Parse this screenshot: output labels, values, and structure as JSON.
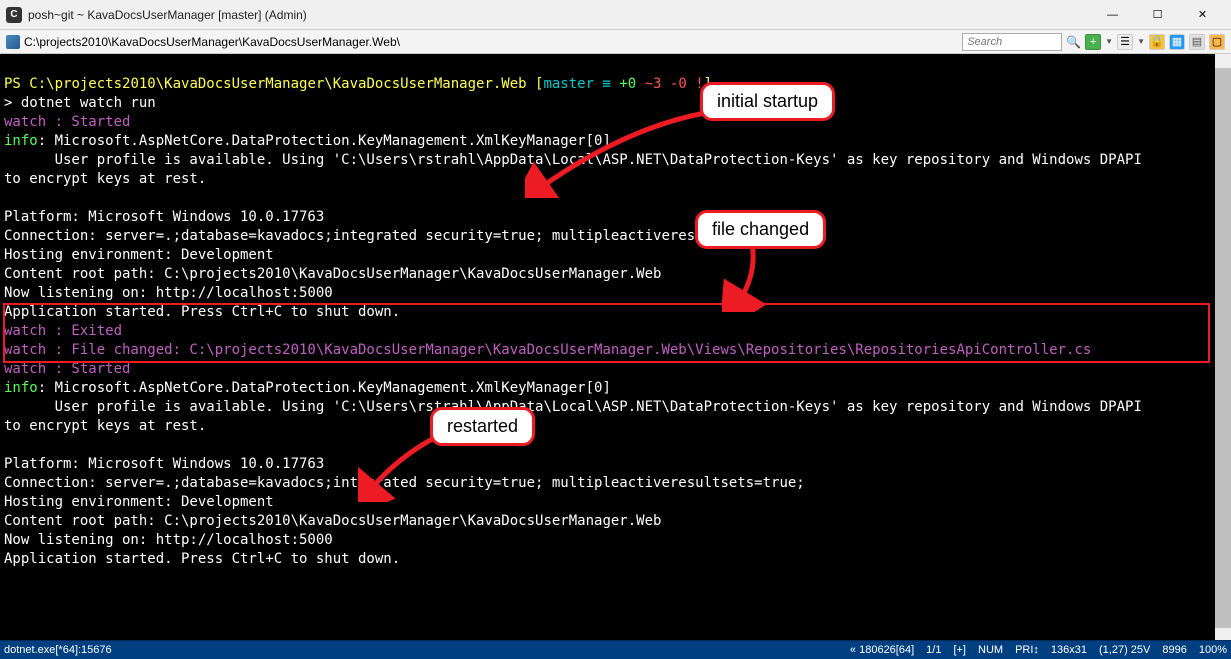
{
  "window": {
    "title": "posh~git ~ KavaDocsUserManager [master] (Admin)"
  },
  "tabbar": {
    "path": "C:\\projects2010\\KavaDocsUserManager\\KavaDocsUserManager.Web\\",
    "search_placeholder": "Search"
  },
  "terminal": {
    "ps_prompt_prefix": "PS ",
    "ps_path": "C:\\projects2010\\KavaDocsUserManager\\KavaDocsUserManager.Web",
    "bracket_open": " [",
    "branch": "master",
    "status_eq": " ≡ ",
    "status_plus": "+0 ",
    "status_tilde": "~3 ",
    "status_minus": "-0 ",
    "status_bang": "!",
    "bracket_close": "]",
    "cmd_prompt": "> ",
    "cmd": "dotnet watch run",
    "watch_started": "watch : Started",
    "info_label": "info",
    "info_colon": ": ",
    "info_line1": "Microsoft.AspNetCore.DataProtection.KeyManagement.XmlKeyManager[0]",
    "info_line2": "      User profile is available. Using 'C:\\Users\\rstrahl\\AppData\\Local\\ASP.NET\\DataProtection-Keys' as key repository and Windows DPAPI",
    "info_line3": "to encrypt keys at rest.",
    "blank": "",
    "platform": "Platform: Microsoft Windows 10.0.17763",
    "connection": "Connection: server=.;database=kavadocs;integrated security=true; multipleactiveresultsets=true;",
    "hosting": "Hosting environment: Development",
    "contentroot": "Content root path: C:\\projects2010\\KavaDocsUserManager\\KavaDocsUserManager.Web",
    "listening": "Now listening on: http://localhost:5000",
    "appstarted": "Application started. Press Ctrl+C to shut down.",
    "watch_exited": "watch : Exited",
    "watch_filechanged": "watch : File changed: C:\\projects2010\\KavaDocsUserManager\\KavaDocsUserManager.Web\\Views\\Repositories\\RepositoriesApiController.cs",
    "watch_started2": "watch : Started",
    "connection2": "Connection: server=.;database=kavadocs;integrated security=true; multipleactiveresultsets=true;"
  },
  "callouts": {
    "initial": "initial startup",
    "filechanged": "file changed",
    "restarted": "restarted"
  },
  "statusbar": {
    "left": "dotnet.exe[*64]:15676",
    "items": [
      "« 180626[64]",
      "1/1",
      "[+]",
      "NUM",
      "PRI↕",
      "136x31",
      "(1,27) 25V",
      "8996",
      "100%"
    ]
  }
}
